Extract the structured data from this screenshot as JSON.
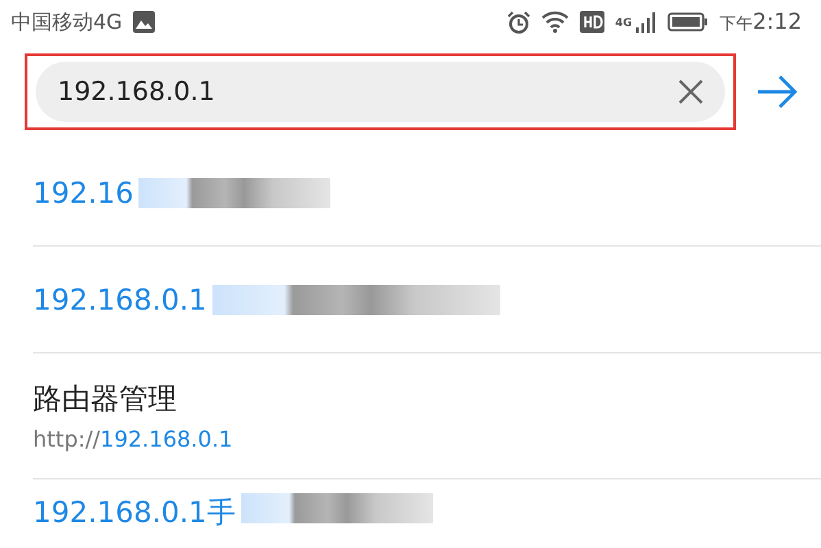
{
  "status_bar": {
    "carrier": "中国移动4G",
    "network": "4G",
    "time_prefix": "下午",
    "time": "2:12"
  },
  "address_bar": {
    "value": "192.168.0.1",
    "highlighted": true
  },
  "suggestions": [
    {
      "kind": "query",
      "text": "192.16",
      "redacted": true
    },
    {
      "kind": "query",
      "text": "192.168.0.1",
      "redacted": true
    },
    {
      "kind": "site",
      "title": "路由器管理",
      "url_scheme": "http://",
      "url_host": "192.168.0.1"
    },
    {
      "kind": "query",
      "text": "192.168.0.1手",
      "redacted": true
    }
  ]
}
